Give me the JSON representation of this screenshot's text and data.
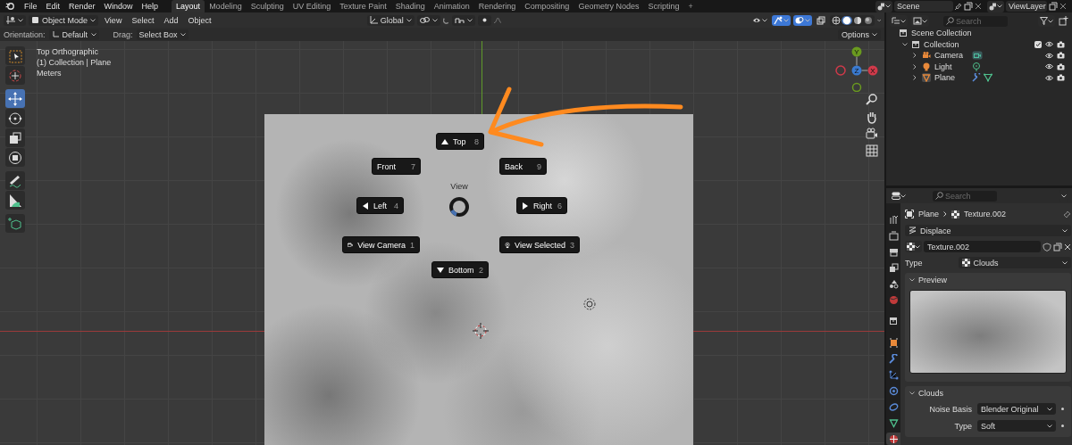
{
  "top_bar": {
    "menus": [
      "File",
      "Edit",
      "Render",
      "Window",
      "Help"
    ],
    "workspaces": [
      {
        "label": "Layout",
        "selected": true
      },
      {
        "label": "Modeling",
        "selected": false
      },
      {
        "label": "Sculpting",
        "selected": false
      },
      {
        "label": "UV Editing",
        "selected": false
      },
      {
        "label": "Texture Paint",
        "selected": false
      },
      {
        "label": "Shading",
        "selected": false
      },
      {
        "label": "Animation",
        "selected": false
      },
      {
        "label": "Rendering",
        "selected": false
      },
      {
        "label": "Compositing",
        "selected": false
      },
      {
        "label": "Geometry Nodes",
        "selected": false
      },
      {
        "label": "Scripting",
        "selected": false
      }
    ],
    "add_tab": "+",
    "scene": "Scene",
    "view_layer": "ViewLayer"
  },
  "viewport": {
    "mode": "Object Mode",
    "menus": [
      "View",
      "Select",
      "Add",
      "Object"
    ],
    "transform_orientation": "Global",
    "toggles": [
      {
        "kind": "visibility",
        "on": false
      },
      {
        "kind": "gizmo",
        "on": true
      },
      {
        "kind": "overlay",
        "on": true
      },
      {
        "kind": "xray",
        "on": false
      }
    ],
    "shading": [
      {
        "kind": "wireframe",
        "selected": false
      },
      {
        "kind": "solid",
        "selected": true
      },
      {
        "kind": "material",
        "selected": false
      },
      {
        "kind": "rendered",
        "selected": false
      }
    ],
    "tool_settings": {
      "orientation_label": "Orientation:",
      "orientation": "Default",
      "drag_label": "Drag:",
      "drag": "Select Box",
      "options": "Options"
    },
    "overlay_text": [
      "Top Orthographic",
      "(1) Collection | Plane",
      "Meters"
    ],
    "tools": [
      {
        "kind": "select_box",
        "selected": false
      },
      {
        "kind": "cursor",
        "selected": false
      },
      {
        "kind": "move",
        "selected": true
      },
      {
        "kind": "rotate",
        "selected": false
      },
      {
        "kind": "scale",
        "selected": false
      },
      {
        "kind": "transform",
        "selected": false
      },
      {
        "kind": "annotate",
        "selected": false
      },
      {
        "kind": "measure",
        "selected": false
      },
      {
        "kind": "add_cube",
        "selected": false
      }
    ],
    "gizmo_axes": [
      "X",
      "Y",
      "Z"
    ],
    "pie_menu": {
      "title": "View",
      "items": [
        {
          "label": "Top",
          "shortcut": "8",
          "kind": "top"
        },
        {
          "label": "Front",
          "shortcut": "7",
          "kind": "front"
        },
        {
          "label": "Back",
          "shortcut": "9",
          "kind": "back"
        },
        {
          "label": "Left",
          "shortcut": "4",
          "kind": "left"
        },
        {
          "label": "Right",
          "shortcut": "6",
          "kind": "right"
        },
        {
          "label": "View Camera",
          "shortcut": "1",
          "kind": "camera"
        },
        {
          "label": "View Selected",
          "shortcut": "3",
          "kind": "selected"
        },
        {
          "label": "Bottom",
          "shortcut": "2",
          "kind": "bottom"
        }
      ]
    }
  },
  "outliner": {
    "search_placeholder": "Search",
    "root": "Scene Collection",
    "collections": [
      {
        "label": "Collection",
        "expanded": true,
        "checked": true,
        "children": [
          {
            "label": "Camera",
            "kind": "camera",
            "expanded": false
          },
          {
            "label": "Light",
            "kind": "light",
            "expanded": false
          },
          {
            "label": "Plane",
            "kind": "mesh",
            "expanded": false
          }
        ]
      }
    ]
  },
  "properties": {
    "search_placeholder": "Search",
    "tabs": [
      {
        "kind": "tool",
        "selected": false
      },
      {
        "kind": "render",
        "selected": false
      },
      {
        "kind": "output",
        "selected": false
      },
      {
        "kind": "view_layer",
        "selected": false
      },
      {
        "kind": "scene",
        "selected": false
      },
      {
        "kind": "world",
        "selected": false
      },
      {
        "kind": "collection",
        "selected": false
      },
      {
        "kind": "object",
        "selected": false
      },
      {
        "kind": "modifier",
        "selected": false
      },
      {
        "kind": "particles",
        "selected": false
      },
      {
        "kind": "physics",
        "selected": false
      },
      {
        "kind": "constraints",
        "selected": false
      },
      {
        "kind": "data",
        "selected": false
      },
      {
        "kind": "texture",
        "selected": true
      }
    ],
    "breadcrumb": [
      "Plane",
      "Texture.002"
    ],
    "modifier": "Displace",
    "texture": "Texture.002",
    "type_label": "Type",
    "type": "Clouds",
    "panels": [
      {
        "kind": "preview",
        "title": "Preview",
        "expanded": true
      },
      {
        "kind": "fields",
        "title": "Clouds",
        "expanded": true,
        "fields": [
          {
            "label": "Noise Basis",
            "value": "Blender Original"
          },
          {
            "label": "Type",
            "value": "Soft"
          }
        ]
      }
    ]
  }
}
